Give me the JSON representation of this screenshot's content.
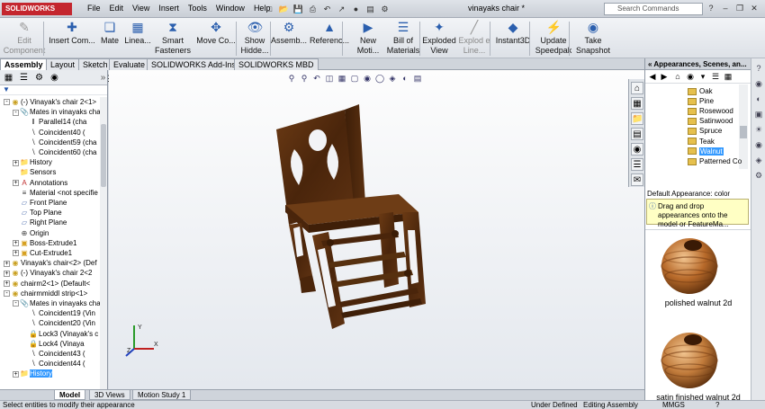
{
  "app": {
    "logo": "SOLIDWORKS",
    "doc_title": "vinayaks chair *",
    "search_placeholder": "Search Commands"
  },
  "menus": [
    "File",
    "Edit",
    "View",
    "Insert",
    "Tools",
    "Window",
    "Help"
  ],
  "commands": [
    {
      "label": "Edit Component",
      "icon": "edit-component-icon",
      "enabled": false
    },
    {
      "label": "Insert Com...",
      "icon": "insert-component-icon",
      "enabled": true
    },
    {
      "label": "Mate",
      "icon": "mate-icon",
      "enabled": true
    },
    {
      "label": "Linea...",
      "icon": "linear-pattern-icon",
      "enabled": true
    },
    {
      "label": "Smart Fasteners",
      "icon": "smart-fasteners-icon",
      "enabled": true
    },
    {
      "label": "Move Co...",
      "icon": "move-component-icon",
      "enabled": true
    },
    {
      "label": "Show Hidde...",
      "icon": "show-hidden-icon",
      "enabled": true
    },
    {
      "label": "Assemb...",
      "icon": "assembly-features-icon",
      "enabled": true
    },
    {
      "label": "Referenc...",
      "icon": "reference-geometry-icon",
      "enabled": true
    },
    {
      "label": "New Moti...",
      "icon": "new-motion-study-icon",
      "enabled": true
    },
    {
      "label": "Bill of Materials",
      "icon": "bill-of-materials-icon",
      "enabled": true
    },
    {
      "label": "Exploded View",
      "icon": "exploded-view-icon",
      "enabled": true
    },
    {
      "label": "Explod e Line...",
      "icon": "explode-line-icon",
      "enabled": false
    },
    {
      "label": "Instant3D",
      "icon": "instant3d-icon",
      "enabled": true
    },
    {
      "label": "Update Speedpak",
      "icon": "update-speedpak-icon",
      "enabled": true
    },
    {
      "label": "Take Snapshot",
      "icon": "take-snapshot-icon",
      "enabled": true
    }
  ],
  "tabs": [
    "Assembly",
    "Layout",
    "Sketch",
    "Evaluate",
    "SOLIDWORKS Add-Ins",
    "SOLIDWORKS MBD"
  ],
  "tree": [
    {
      "label": "(-) Vinayak's chair 2<1>",
      "lvl": 0,
      "ex": "-",
      "ic": "part-icon"
    },
    {
      "label": "Mates in vinayaks chai",
      "lvl": 1,
      "ex": "-",
      "ic": "mates-folder-icon"
    },
    {
      "label": "Parallel14 (cha",
      "lvl": 2,
      "ex": "",
      "ic": "parallel-mate-icon"
    },
    {
      "label": "Coincident40 (",
      "lvl": 2,
      "ex": "",
      "ic": "coincident-mate-icon"
    },
    {
      "label": "Coincident59 (cha",
      "lvl": 2,
      "ex": "",
      "ic": "coincident-mate-icon"
    },
    {
      "label": "Coincident60 (cha",
      "lvl": 2,
      "ex": "",
      "ic": "coincident-mate-icon"
    },
    {
      "label": "History",
      "lvl": 1,
      "ex": "+",
      "ic": "history-icon"
    },
    {
      "label": "Sensors",
      "lvl": 1,
      "ex": "",
      "ic": "sensors-icon"
    },
    {
      "label": "Annotations",
      "lvl": 1,
      "ex": "+",
      "ic": "annotations-icon"
    },
    {
      "label": "Material <not specifie",
      "lvl": 1,
      "ex": "",
      "ic": "material-icon"
    },
    {
      "label": "Front Plane",
      "lvl": 1,
      "ex": "",
      "ic": "plane-icon"
    },
    {
      "label": "Top Plane",
      "lvl": 1,
      "ex": "",
      "ic": "plane-icon"
    },
    {
      "label": "Right Plane",
      "lvl": 1,
      "ex": "",
      "ic": "plane-icon"
    },
    {
      "label": "Origin",
      "lvl": 1,
      "ex": "",
      "ic": "origin-icon"
    },
    {
      "label": "Boss-Extrude1",
      "lvl": 1,
      "ex": "+",
      "ic": "extrude-icon"
    },
    {
      "label": "Cut-Extrude1",
      "lvl": 1,
      "ex": "+",
      "ic": "cut-extrude-icon"
    },
    {
      "label": "Vinayak's chair<2> (Def",
      "lvl": 0,
      "ex": "+",
      "ic": "part-icon"
    },
    {
      "label": "(-) Vinayak's chair 2<2",
      "lvl": 0,
      "ex": "+",
      "ic": "part-icon"
    },
    {
      "label": "chairm2<1> (Default<",
      "lvl": 0,
      "ex": "+",
      "ic": "part-icon"
    },
    {
      "label": "chairmmiddl strip<1>",
      "lvl": 0,
      "ex": "-",
      "ic": "part-icon"
    },
    {
      "label": "Mates in vinayaks chai",
      "lvl": 1,
      "ex": "-",
      "ic": "mates-folder-icon"
    },
    {
      "label": "Coincident19 (Vin",
      "lvl": 2,
      "ex": "",
      "ic": "coincident-mate-icon"
    },
    {
      "label": "Coincident20 (Vin",
      "lvl": 2,
      "ex": "",
      "ic": "coincident-mate-icon"
    },
    {
      "label": "Lock3 (Vinayak's c",
      "lvl": 2,
      "ex": "",
      "ic": "lock-mate-icon"
    },
    {
      "label": "Lock4 (Vinaya",
      "lvl": 2,
      "ex": "",
      "ic": "lock-mate-icon"
    },
    {
      "label": "Coincident43 (",
      "lvl": 2,
      "ex": "",
      "ic": "coincident-mate-icon"
    },
    {
      "label": "Coincident44 (",
      "lvl": 2,
      "ex": "",
      "ic": "coincident-mate-icon"
    },
    {
      "label": "History",
      "lvl": 1,
      "ex": "+",
      "ic": "history-icon",
      "sel": true
    }
  ],
  "bottom_tabs": [
    "Model",
    "3D Views",
    "Motion Study 1"
  ],
  "status": {
    "hint": "Select entities to modify their appearance",
    "state": "Under Defined",
    "mode": "Editing Assembly",
    "units": "MMGS"
  },
  "taskpane": {
    "title": "Appearances, Scenes, an...",
    "woods": [
      "Oak",
      "Pine",
      "Rosewood",
      "Satinwood",
      "Spruce",
      "Teak",
      "Walnut",
      "Patterned Co"
    ],
    "selected_wood": "Walnut",
    "default_appearance": "Default Appearance: color",
    "tip": "Drag and drop appearances onto the model or FeatureMa...",
    "swatches": [
      {
        "label": "polished walnut 2d",
        "color": "#b86a2a"
      },
      {
        "label": "satin finished walnut 2d",
        "color": "#c07a3a"
      }
    ]
  }
}
